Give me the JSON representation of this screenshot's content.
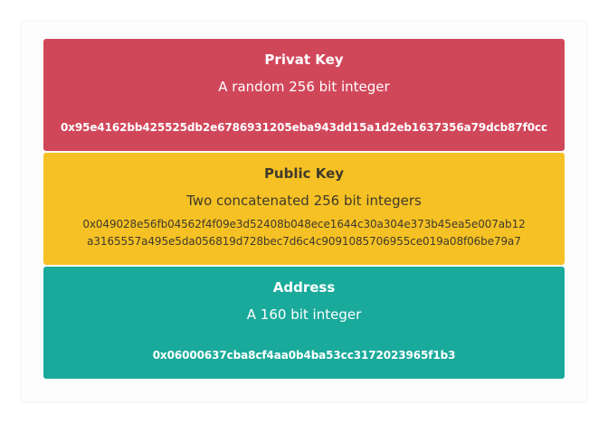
{
  "cards": [
    {
      "title": "Privat Key",
      "subtitle": "A random 256 bit integer",
      "value": "0x95e4162bb425525db2e6786931205eba943dd15a1d2eb1637356a79dcb87f0cc",
      "color": "#d1475a"
    },
    {
      "title": "Public Key",
      "subtitle": "Two concatenated 256 bit integers",
      "value_line1": "0x049028e56fb04562f4f09e3d52408b048ece1644c30a304e373b45ea5e007ab12",
      "value_line2": "a3165557a495e5da056819d728bec7d6c4c9091085706955ce019a08f06be79a7",
      "color": "#f6c124"
    },
    {
      "title": "Address",
      "subtitle": "A 160 bit integer",
      "value": "0x06000637cba8cf4aa0b4ba53cc3172023965f1b3",
      "color": "#1aaa9b"
    }
  ]
}
